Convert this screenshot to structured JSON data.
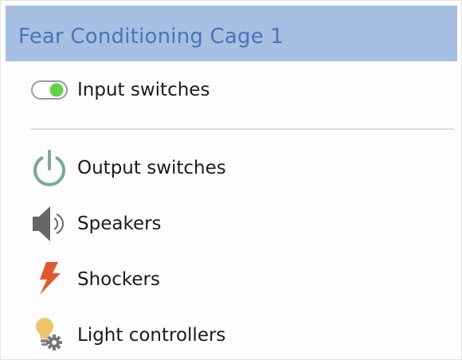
{
  "panel": {
    "title": "Fear Conditioning Cage 1"
  },
  "items": [
    {
      "label": "Input switches",
      "icon": "toggle-on-icon",
      "icon_color": "#5fd24a"
    },
    {
      "label": "Output switches",
      "icon": "power-icon",
      "icon_color": "#7aa899"
    },
    {
      "label": "Speakers",
      "icon": "speaker-icon",
      "icon_color": "#666666"
    },
    {
      "label": "Shockers",
      "icon": "lightning-bolt-icon",
      "icon_color": "#e0582f"
    },
    {
      "label": "Light controllers",
      "icon": "light-bulb-gear-icon",
      "icon_color": "#eac56a"
    }
  ],
  "colors": {
    "header_background": "#a6bfe3",
    "header_text": "#4a74b6"
  }
}
